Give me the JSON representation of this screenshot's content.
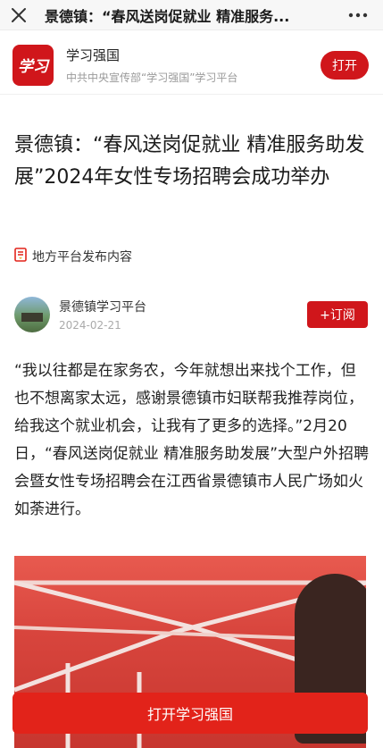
{
  "topbar": {
    "title": "景德镇：“春风送岗促就业 精准服务...",
    "close_icon": "close-icon",
    "more_icon": "more-icon"
  },
  "appbar": {
    "logo_text": "学习",
    "app_name": "学习强国",
    "app_subtitle": "中共中央宣传部“学习强国”学习平台",
    "open_label": "打开"
  },
  "article": {
    "headline": "景德镇：“春风送岗促就业 精准服务助发展”2024年女性专场招聘会成功举办",
    "source_label": "地方平台发布内容",
    "author_name": "景德镇学习平台",
    "publish_date": "2024-02-21",
    "subscribe_label": "+订阅",
    "body": "“我以往都是在家务农，今年就想出来找个工作，但也不想离家太远，感谢景德镇市妇联帮我推荐岗位，给我这个就业机会，让我有了更多的选择。”2月20日，“春风送岗促就业 精准服务助发展”大型户外招聘会暨女性专场招聘会在江西省景德镇市人民广场如火如荼进行。"
  },
  "cta": {
    "label": "打开学习强国"
  },
  "colors": {
    "brand_red": "#d0161b",
    "cta_red": "#e2231a"
  }
}
